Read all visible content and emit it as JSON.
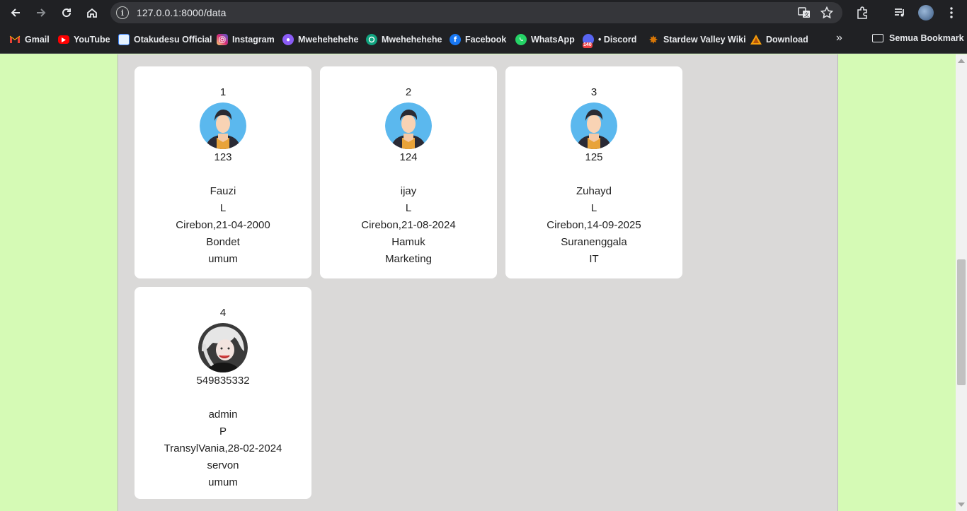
{
  "browser": {
    "url": "127.0.0.1:8000/data",
    "bookmarks": [
      {
        "label": "Gmail",
        "icon": "gmail-icon",
        "color": "#ea4335"
      },
      {
        "label": "YouTube",
        "icon": "youtube-icon",
        "color": "#ff0000"
      },
      {
        "label": "Otakudesu Official",
        "icon": "otakudesu-icon",
        "color": "#3b82f6"
      },
      {
        "label": "Instagram",
        "icon": "instagram-icon",
        "color": "#d62976"
      },
      {
        "label": "Mwehehehehe",
        "icon": "chat-bot-icon",
        "color": "#8b5cf6"
      },
      {
        "label": "Mwehehehehe",
        "icon": "openai-icon",
        "color": "#10a37f"
      },
      {
        "label": "Facebook",
        "icon": "facebook-icon",
        "color": "#1877f2"
      },
      {
        "label": "WhatsApp",
        "icon": "whatsapp-icon",
        "color": "#25d366"
      },
      {
        "label": "• Discord",
        "icon": "discord-icon",
        "color": "#5865f2"
      },
      {
        "label": "Stardew Valley Wiki",
        "icon": "stardew-icon",
        "color": "#d97706"
      },
      {
        "label": "Download",
        "icon": "download-site-icon",
        "color": "#f59e0b"
      }
    ],
    "discord_badge": "140",
    "all_bookmarks": "Semua Bookmark"
  },
  "cards": [
    {
      "no": "1",
      "id": "123",
      "name": "Fauzi",
      "gender": "L",
      "birth": "Cirebon,21-04-2000",
      "address": "Bondet",
      "division": "umum",
      "avatar": "default"
    },
    {
      "no": "2",
      "id": "124",
      "name": "ijay",
      "gender": "L",
      "birth": "Cirebon,21-08-2024",
      "address": "Hamuk",
      "division": "Marketing",
      "avatar": "default"
    },
    {
      "no": "3",
      "id": "125",
      "name": "Zuhayd",
      "gender": "L",
      "birth": "Cirebon,14-09-2025",
      "address": "Suranenggala",
      "division": "IT",
      "avatar": "default"
    },
    {
      "no": "4",
      "id": "549835332",
      "name": "admin",
      "gender": "P",
      "birth": "TransylVania,28-02-2024",
      "address": "servon",
      "division": "umum",
      "avatar": "photo"
    }
  ],
  "colors": {
    "page_bg": "#d5fab5",
    "container_bg": "#dad9d8",
    "avatar_bg": "#5bb8ee"
  }
}
